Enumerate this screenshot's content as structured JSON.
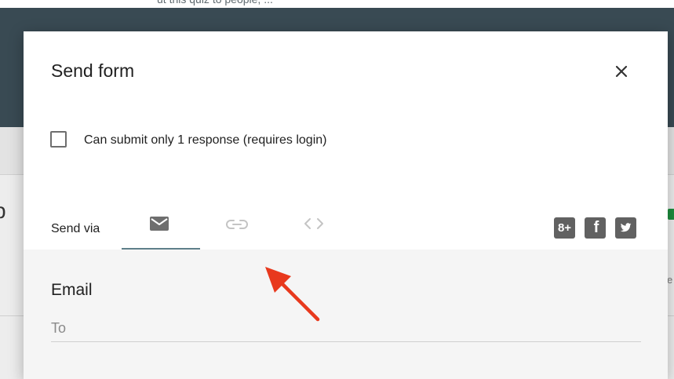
{
  "background": {
    "top_cropped_text": "ut this quiz to people, ...",
    "left_cropped_letter": "p",
    "right_cropped_char": "e",
    "header_color": "#394a53",
    "status_tag_color": "#1e8e3e"
  },
  "dialog": {
    "title": "Send form",
    "close_icon": "close-icon",
    "checkbox": {
      "label": "Can submit only 1 response (requires login)",
      "checked": false
    },
    "send_via": {
      "label": "Send via",
      "tabs": [
        {
          "name": "email",
          "icon": "email-icon",
          "active": true
        },
        {
          "name": "link",
          "icon": "link-icon",
          "active": false
        },
        {
          "name": "embed",
          "icon": "embed-code-icon",
          "active": false
        }
      ],
      "social": [
        {
          "name": "google-plus",
          "icon": "google-plus-icon",
          "label": "8+"
        },
        {
          "name": "facebook",
          "icon": "facebook-icon",
          "label": "f"
        },
        {
          "name": "twitter",
          "icon": "twitter-icon",
          "label": ""
        }
      ]
    },
    "email_panel": {
      "title": "Email",
      "to_placeholder": "To",
      "to_value": ""
    }
  },
  "annotation": {
    "arrow_color": "#e8391d",
    "points_to": "link tab"
  },
  "colors": {
    "active_underline": "#5f7f8a",
    "icon_active": "#6e6e6e",
    "icon_inactive": "#c4c4c4",
    "social_bg": "#616161"
  }
}
